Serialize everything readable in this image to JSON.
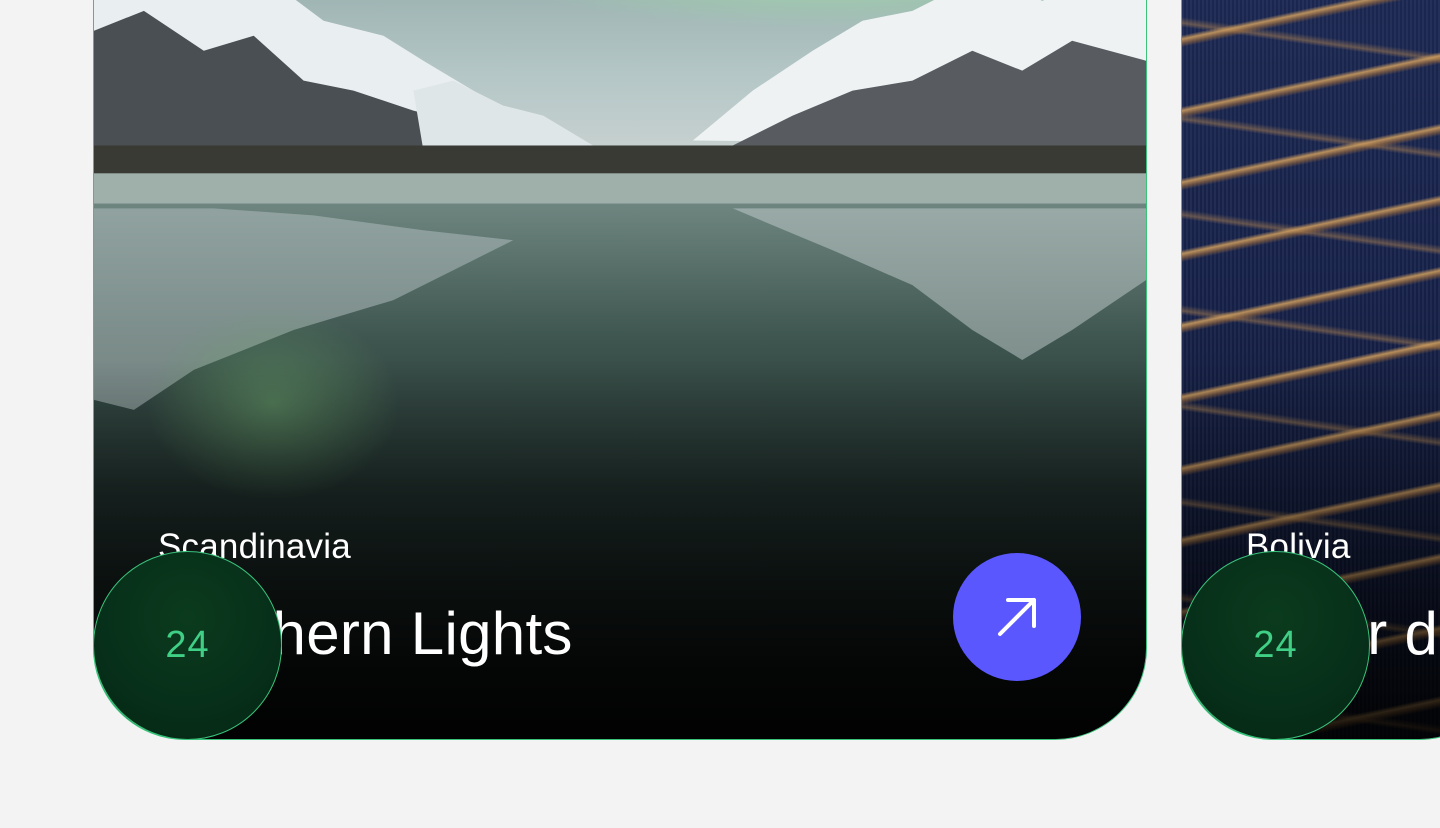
{
  "cards": [
    {
      "region": "Scandinavia",
      "title": "Northern Lights",
      "badge": "24",
      "image": "mountain-lake-reflection"
    },
    {
      "region": "Bolivia",
      "title": "Salar de Uyuni",
      "badge": "24",
      "image": "salt-flat-texture"
    }
  ],
  "icons": {
    "open": "arrow-up-right-icon"
  },
  "colors": {
    "background": "#f3f3f3",
    "card_border": "#39c37b",
    "badge_text": "#3fcf85",
    "badge_fill": "#07301a",
    "button": "#5b57ff",
    "text": "#ffffff"
  }
}
